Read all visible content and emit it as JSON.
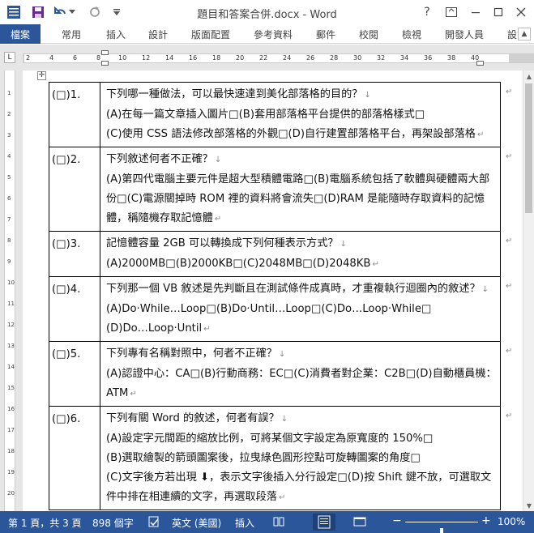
{
  "titlebar": {
    "title": "題目和答案合併.docx - Word",
    "help_label": "?",
    "icons": [
      "word-logo-icon",
      "save-icon",
      "undo-icon",
      "redo-icon",
      "customize-quick-access-icon",
      "ribbon-display-options-icon",
      "minimize-icon",
      "maximize-icon",
      "close-icon"
    ]
  },
  "ribbon": {
    "file_tab": "檔案",
    "tabs": [
      "常用",
      "插入",
      "設計",
      "版面配置",
      "參考資料",
      "郵件",
      "校閱",
      "檢視",
      "開發人員",
      "設計"
    ]
  },
  "ruler": {
    "h_numbers": [
      "2",
      "4",
      "6",
      "8",
      "10",
      "12",
      "14",
      "16",
      "18",
      "20",
      "22",
      "24",
      "26",
      "28",
      "30",
      "32",
      "34",
      "36",
      "38",
      "40"
    ],
    "v_numbers": [
      "1",
      "2",
      "3",
      "4",
      "5",
      "6",
      "7",
      "8",
      "9",
      "10",
      "11",
      "12",
      "13",
      "14",
      "15",
      "16",
      "17",
      "18",
      "19",
      "20",
      "21"
    ]
  },
  "questions": [
    {
      "num": "(□)1.",
      "stem": "下列哪一種做法，可以最快速達到美化部落格的目的？",
      "options": [
        "(A)在每一篇文章插入圖片□(B)套用部落格平台提供的部落格樣式□",
        "(C)使用 CSS 語法修改部落格的外觀□(D)自行建置部落格平台，再架設部落格"
      ]
    },
    {
      "num": "(□)2.",
      "stem": "下列敘述何者不正確？",
      "options": [
        "(A)第四代電腦主要元件是超大型積體電路□(B)電腦系統包括了軟體與硬體兩大部份□(C)電源關掉時 ROM 裡的資料將會流失□(D)RAM 是能隨時存取資料的記憶體，稱隨機存取記憶體"
      ]
    },
    {
      "num": "(□)3.",
      "stem": "記憶體容量 2GB 可以轉換成下列何種表示方式？",
      "options": [
        "(A)2000MB□(B)2000KB□(C)2048MB□(D)2048KB"
      ]
    },
    {
      "num": "(□)4.",
      "stem": "下列那一個 VB 敘述是先判斷且在測試條件成真時，才重複執行迴圈內的敘述？",
      "options": [
        "(A)Do·While…Loop□(B)Do·Until…Loop□(C)Do…Loop·While□",
        "(D)Do…Loop·Until"
      ]
    },
    {
      "num": "(□)5.",
      "stem": "下列專有名稱對照中，何者不正確？",
      "options": [
        "(A)認證中心：CA□(B)行動商務：EC□(C)消費者對企業：C2B□(D)自動櫃員機：ATM"
      ]
    },
    {
      "num": "(□)6.",
      "stem": "下列有關 Word 的敘述，何者有誤？",
      "options": [
        "(A)設定字元間距的縮放比例，可將某個文字設定為原寬度的 150%□",
        "(B)選取繪製的箭頭圖案後，拉曳綠色圓形控點可旋轉圖案的角度□",
        "(C)文字後方若出現 ⬇，表示文字後插入分行設定□(D)按 Shift 鍵不放，可選取文件中排在相連續的文字，再選取段落"
      ]
    }
  ],
  "marks": {
    "line_break": "↓",
    "paragraph_end": "↵",
    "cell_end": "↵"
  },
  "status": {
    "page": "第 1 頁，共 3 頁",
    "words": "898 個字",
    "language": "英文 (美國)",
    "mode": "插入",
    "zoom": "100%",
    "zoom_minus": "−",
    "zoom_plus": "+",
    "zoom_level": 1.0
  },
  "colors": {
    "accent": "#2b579a",
    "text": "#111111",
    "ruler_bg": "#e6e6e6"
  }
}
